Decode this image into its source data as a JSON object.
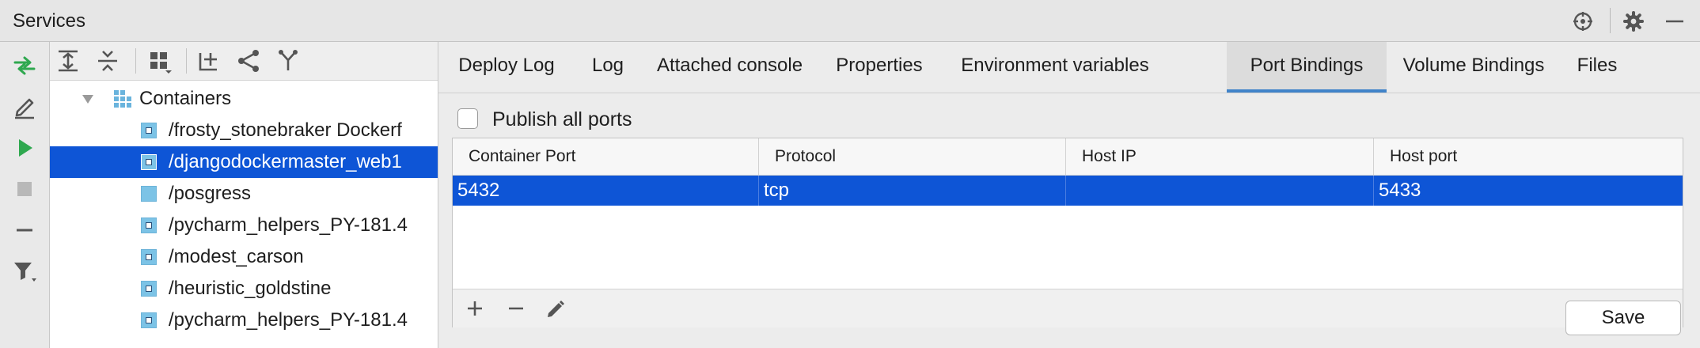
{
  "window": {
    "title": "Services"
  },
  "tree": {
    "root_label": "Containers",
    "items": [
      {
        "label": "/frosty_stonebraker Dockerf"
      },
      {
        "label": "/djangodockermaster_web1"
      },
      {
        "label": "/posgress"
      },
      {
        "label": "/pycharm_helpers_PY-181.4"
      },
      {
        "label": "/modest_carson"
      },
      {
        "label": "/heuristic_goldstine"
      },
      {
        "label": "/pycharm_helpers_PY-181.4"
      }
    ],
    "selected_index": 1
  },
  "tabs": [
    {
      "label": "Deploy Log"
    },
    {
      "label": "Log"
    },
    {
      "label": "Attached console"
    },
    {
      "label": "Properties"
    },
    {
      "label": "Environment variables"
    },
    {
      "label": "Port Bindings"
    },
    {
      "label": "Volume Bindings"
    },
    {
      "label": "Files"
    }
  ],
  "active_tab": "Port Bindings",
  "port_bindings": {
    "publish_all_label": "Publish all ports",
    "publish_all_checked": false,
    "columns": [
      "Container Port",
      "Protocol",
      "Host IP",
      "Host port"
    ],
    "rows": [
      {
        "container_port": "5432",
        "protocol": "tcp",
        "host_ip": "",
        "host_port": "5433"
      }
    ],
    "save_label": "Save"
  },
  "colors": {
    "selection": "#0e55d6",
    "active_tab_underline": "#4083c9",
    "run_icon": "#2fa84f",
    "container_icon": "#7cc3e6"
  }
}
